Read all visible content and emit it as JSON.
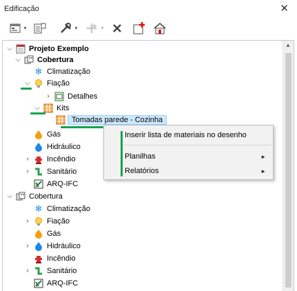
{
  "window": {
    "title": "Edificação",
    "close_glyph": "✕"
  },
  "toolbar": {
    "buttons": [
      {
        "name": "new-element-button",
        "icon": "new-element-icon",
        "dropdown": true,
        "enabled": true
      },
      {
        "name": "properties-button",
        "icon": "properties-icon",
        "dropdown": false,
        "enabled": true
      },
      {
        "name": "tools-button",
        "icon": "tools-icon",
        "dropdown": true,
        "enabled": true
      },
      {
        "name": "add-element-button",
        "icon": "add-element-icon",
        "dropdown": true,
        "enabled": false
      },
      {
        "name": "delete-button",
        "icon": "delete-icon",
        "dropdown": false,
        "enabled": true
      },
      {
        "name": "add-floor-button",
        "icon": "add-floor-icon",
        "dropdown": false,
        "enabled": true
      },
      {
        "name": "building-button",
        "icon": "building-icon",
        "dropdown": false,
        "enabled": true
      }
    ]
  },
  "tree": {
    "root": {
      "label": "Projeto Exemplo",
      "icon": "project-icon"
    },
    "floor1": {
      "label": "Cobertura",
      "icon": "floor-icon",
      "climatizacao": "Climatização",
      "fiacao": "Fiação",
      "detalhes": "Detalhes",
      "kits": "Kits",
      "tomadas": "Tomadas parede - Cozinha",
      "gas": "Gás",
      "hidraulico": "Hidráulico",
      "incendio": "Incêndio",
      "sanitario": "Sanitário",
      "arq_ifc": "ARQ-IFC"
    },
    "floor2": {
      "label": "Cobertura",
      "climatizacao": "Climatização",
      "fiacao": "Fiação",
      "gas": "Gás",
      "hidraulico": "Hidráulico",
      "incendio": "Incêndio",
      "sanitario": "Sanitário",
      "arq_ifc": "ARQ-IFC"
    }
  },
  "context_menu": {
    "items": [
      {
        "label": "Inserir lista de materiais no desenho",
        "submenu": false
      },
      {
        "label": "Planilhas",
        "submenu": true
      },
      {
        "label": "Relatórios",
        "submenu": true
      }
    ],
    "submenu_glyph": "►"
  },
  "colors": {
    "accent_marker": "#16a34a",
    "selection_bg": "#cce8ff",
    "selection_border": "#99d1ff"
  }
}
